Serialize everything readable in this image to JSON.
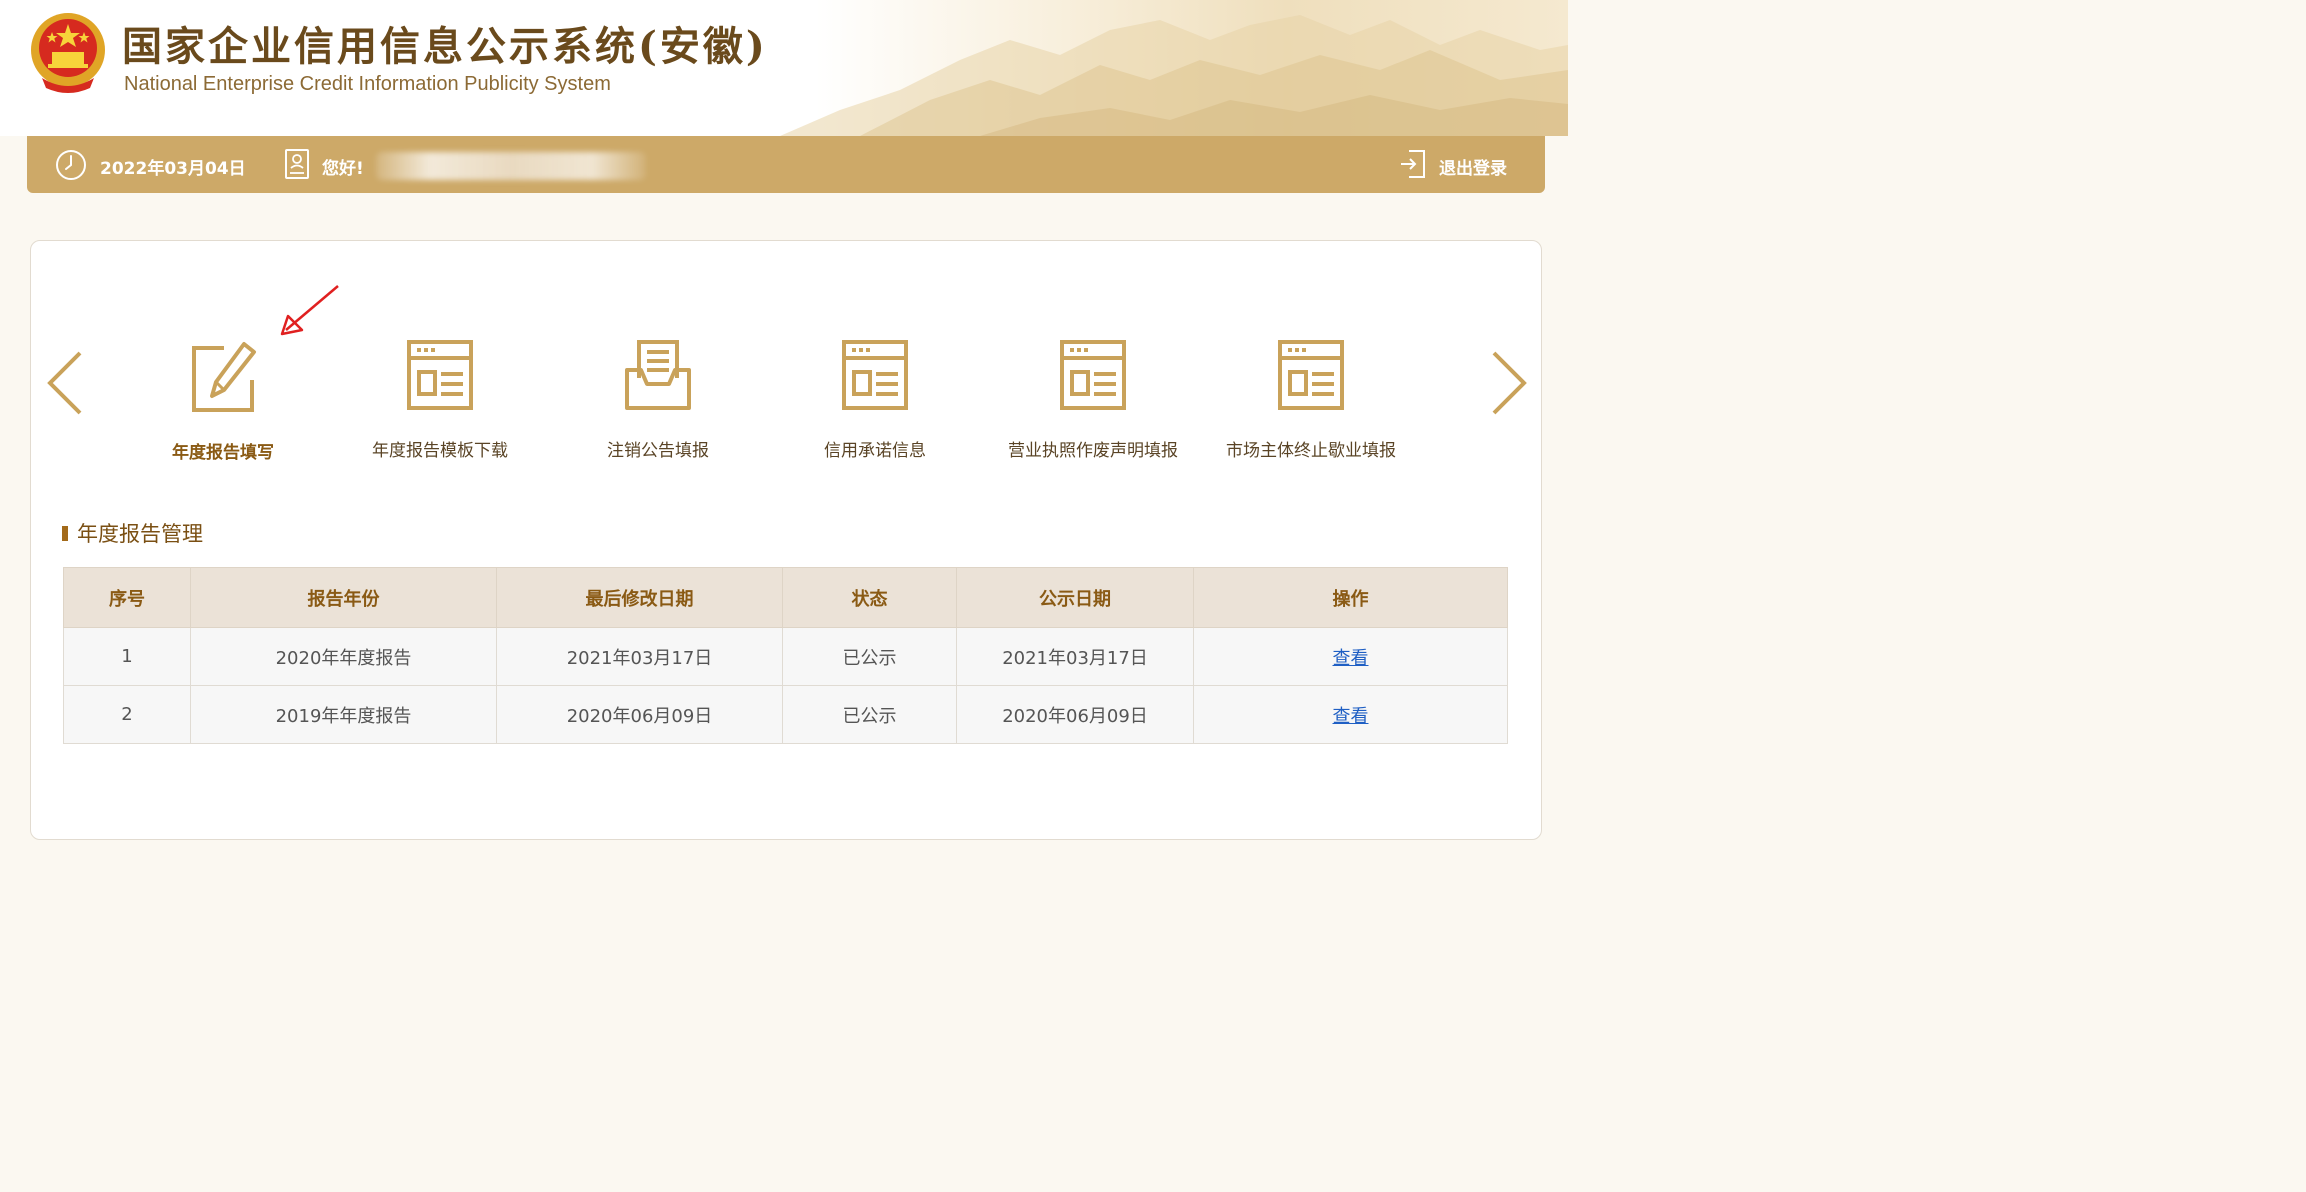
{
  "header": {
    "title_cn": "国家企业信用信息公示系统(安徽)",
    "title_en": "National Enterprise Credit Information Publicity System",
    "emblem_icon": "national-emblem-icon"
  },
  "userbar": {
    "date": "2022年03月04日",
    "greeting": "您好!",
    "logout_label": "退出登录",
    "icons": [
      "clock-icon",
      "user-card-icon",
      "logout-icon"
    ],
    "color": "#cda968"
  },
  "functions": [
    {
      "label": "年度报告填写",
      "icon": "edit-document-icon",
      "active": true
    },
    {
      "label": "年度报告模板下载",
      "icon": "template-doc-icon",
      "active": false
    },
    {
      "label": "注销公告填报",
      "icon": "inbox-document-icon",
      "active": false
    },
    {
      "label": "信用承诺信息",
      "icon": "template-doc-icon",
      "active": false
    },
    {
      "label": "营业执照作废声明填报",
      "icon": "template-doc-icon",
      "active": false
    },
    {
      "label": "市场主体终止歇业填报",
      "icon": "template-doc-icon",
      "active": false
    }
  ],
  "section": {
    "title": "年度报告管理"
  },
  "table": {
    "headers": [
      "序号",
      "报告年份",
      "最后修改日期",
      "状态",
      "公示日期",
      "操作"
    ],
    "rows": [
      [
        "1",
        "2020年年度报告",
        "2021年03月17日",
        "已公示",
        "2021年03月17日",
        "查看"
      ],
      [
        "2",
        "2019年年度报告",
        "2020年06月09日",
        "已公示",
        "2020年06月09日",
        "查看"
      ]
    ]
  },
  "colors": {
    "gold": "#cda968",
    "icon_gold": "#c9a25a",
    "text_brown": "#7a4f13",
    "link_blue": "#1f5fc4",
    "annotation_red": "#e02020"
  }
}
